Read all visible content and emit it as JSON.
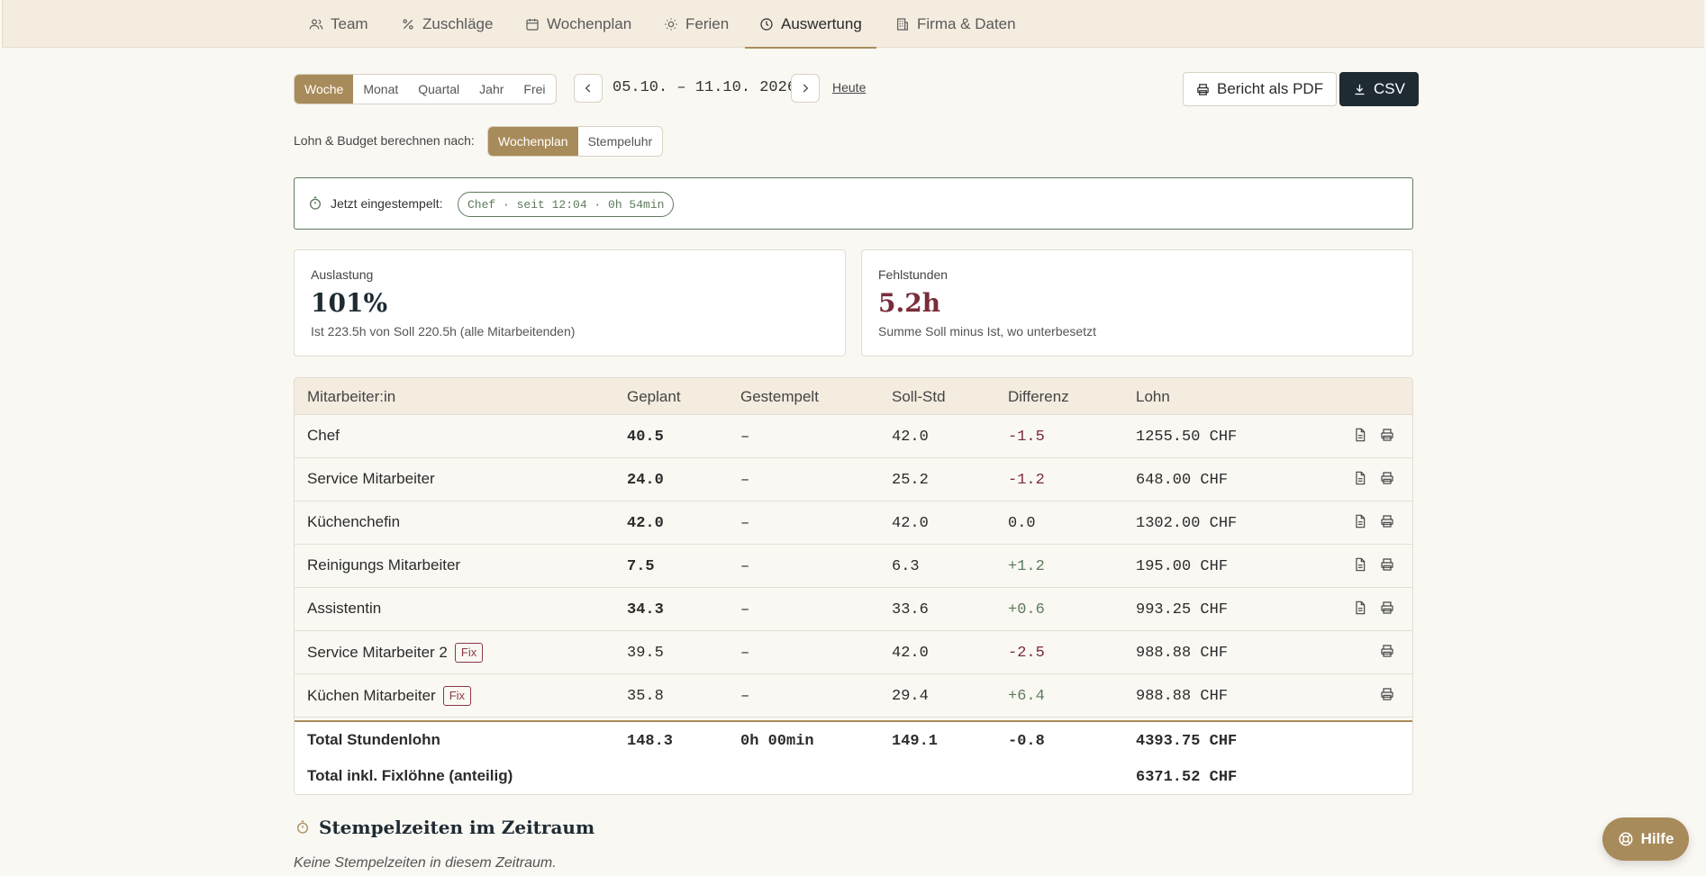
{
  "nav": {
    "tabs": [
      {
        "label": "Team",
        "icon": "users-icon"
      },
      {
        "label": "Zuschläge",
        "icon": "percent-icon"
      },
      {
        "label": "Wochenplan",
        "icon": "calendar-icon"
      },
      {
        "label": "Ferien",
        "icon": "sun-icon"
      },
      {
        "label": "Auswertung",
        "icon": "clock-icon",
        "active": true
      },
      {
        "label": "Firma & Daten",
        "icon": "building-icon"
      }
    ]
  },
  "period": {
    "options": [
      "Woche",
      "Monat",
      "Quartal",
      "Jahr",
      "Frei"
    ],
    "selected": "Woche",
    "range": "05.10. – 11.10. 2026",
    "today_label": "Heute"
  },
  "actions": {
    "pdf_label": "Bericht als PDF",
    "csv_label": "CSV"
  },
  "calc": {
    "label": "Lohn & Budget berechnen nach:",
    "options": [
      "Wochenplan",
      "Stempeluhr"
    ],
    "selected": "Wochenplan"
  },
  "clocked_in": {
    "label": "Jetzt eingestempelt:",
    "entry": "Chef · seit 12:04 · 0h 54min"
  },
  "stats": {
    "utilization": {
      "title": "Auslastung",
      "value": "101%",
      "sub": "Ist 223.5h von Soll 220.5h (alle Mitarbeitenden)"
    },
    "missing": {
      "title": "Fehlstunden",
      "value": "5.2h",
      "sub": "Summe Soll minus Ist, wo unterbesetzt"
    }
  },
  "table": {
    "headers": [
      "Mitarbeiter:in",
      "Geplant",
      "Gestempelt",
      "Soll-Std",
      "Differenz",
      "Lohn"
    ],
    "rows": [
      {
        "name": "Chef",
        "fix": "",
        "planned": "40.5",
        "clocked": "–",
        "target": "42.0",
        "diff": "-1.5",
        "wage": "1255.50 CHF"
      },
      {
        "name": "Service Mitarbeiter",
        "fix": "",
        "planned": "24.0",
        "clocked": "–",
        "target": "25.2",
        "diff": "-1.2",
        "wage": "648.00 CHF"
      },
      {
        "name": "Küchenchefin",
        "fix": "",
        "planned": "42.0",
        "clocked": "–",
        "target": "42.0",
        "diff": "0.0",
        "wage": "1302.00 CHF"
      },
      {
        "name": "Reinigungs Mitarbeiter",
        "fix": "",
        "planned": "7.5",
        "clocked": "–",
        "target": "6.3",
        "diff": "+1.2",
        "wage": "195.00 CHF"
      },
      {
        "name": "Assistentin",
        "fix": "",
        "planned": "34.3",
        "clocked": "–",
        "target": "33.6",
        "diff": "+0.6",
        "wage": "993.25 CHF"
      },
      {
        "name": "Service Mitarbeiter 2",
        "fix": "Fix",
        "planned": "39.5",
        "clocked": "–",
        "target": "42.0",
        "diff": "-2.5",
        "wage": "988.88 CHF"
      },
      {
        "name": "Küchen Mitarbeiter",
        "fix": "Fix",
        "planned": "35.8",
        "clocked": "–",
        "target": "29.4",
        "diff": "+6.4",
        "wage": "988.88 CHF"
      }
    ],
    "total_hourly": {
      "label": "Total Stundenlohn",
      "planned": "148.3",
      "clocked": "0h 00min",
      "target": "149.1",
      "diff": "-0.8",
      "wage": "4393.75 CHF"
    },
    "total_fixed": {
      "label": "Total inkl. Fixlöhne (anteilig)",
      "wage": "6371.52 CHF"
    }
  },
  "clock_section": {
    "title": "Stempelzeiten im Zeitraum",
    "empty": "Keine Stempelzeiten in diesem Zeitraum."
  },
  "help": {
    "label": "Hilfe"
  },
  "colors": {
    "accent": "#a88b5a",
    "dark": "#1f2b33",
    "negative": "#7a2c3a",
    "positive": "#5e7a5c"
  }
}
